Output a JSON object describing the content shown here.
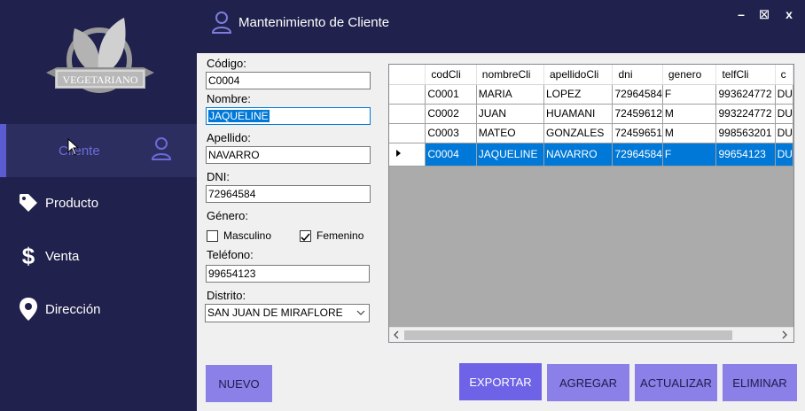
{
  "window": {
    "title": "Mantenimiento de Cliente",
    "controls": [
      "minimize",
      "maximize",
      "close"
    ],
    "min_glyph": "–",
    "max_glyph": "⊠",
    "close_glyph": "x"
  },
  "sidebar": {
    "logo_text": "VEGETARIANO",
    "items": [
      {
        "label": "Cliente",
        "icon": "user-icon",
        "active": true
      },
      {
        "label": "Producto",
        "icon": "tag-icon"
      },
      {
        "label": "Venta",
        "icon": "dollar-icon"
      },
      {
        "label": "Dirección",
        "icon": "location-pin-icon"
      }
    ]
  },
  "form": {
    "codigo_label": "Código:",
    "codigo_value": "C0004",
    "nombre_label": "Nombre:",
    "nombre_value": "JAQUELINE",
    "apellido_label": "Apellido:",
    "apellido_value": "NAVARRO",
    "dni_label": "DNI:",
    "dni_value": "72964584",
    "genero_label": "Género:",
    "masculino_label": "Masculino",
    "masculino_checked": false,
    "femenino_label": "Femenino",
    "femenino_checked": true,
    "telefono_label": "Teléfono:",
    "telefono_value": "99654123",
    "distrito_label": "Distrito:",
    "distrito_value": "SAN JUAN DE MIRAFLORE"
  },
  "grid": {
    "columns": [
      "codCli",
      "nombreCli",
      "apellidoCli",
      "dni",
      "genero",
      "telfCli",
      "c"
    ],
    "rows": [
      [
        "C0001",
        "MARIA",
        "LOPEZ",
        "72964584",
        "F",
        "993624772",
        "DU"
      ],
      [
        "C0002",
        "JUAN",
        "HUAMANI",
        "72459612",
        "M",
        "993224772",
        "DU"
      ],
      [
        "C0003",
        "MATEO",
        "GONZALES",
        "72459651",
        "M",
        "998563201",
        "DU"
      ],
      [
        "C0004",
        "JAQUELINE",
        "NAVARRO",
        "72964584",
        "F",
        "99654123",
        "DU"
      ]
    ],
    "selected_row": 3
  },
  "buttons": {
    "nuevo": "NUEVO",
    "exportar": "EXPORTAR",
    "agregar": "AGREGAR",
    "actualizar": "ACTUALIZAR",
    "eliminar": "ELIMINAR"
  },
  "colors": {
    "sidebar_bg": "#20214d",
    "accent": "#5b5cd2",
    "button": "#8b7fe8",
    "selection": "#0078d7"
  }
}
